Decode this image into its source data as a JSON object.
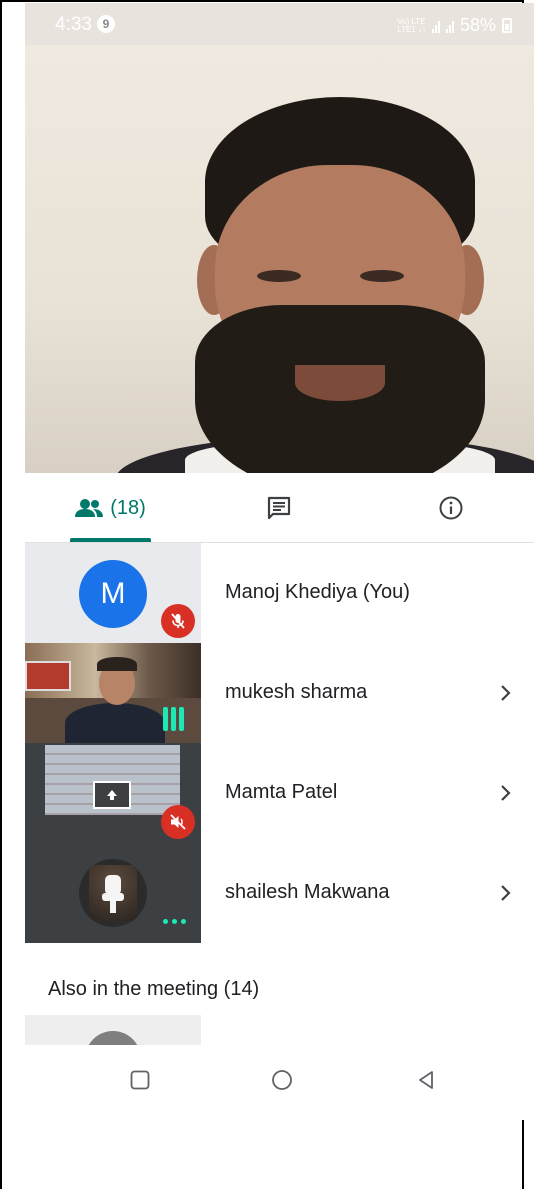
{
  "status_bar": {
    "time": "4:33",
    "notification_count": "9",
    "network_label": "Vo) LTE\nLTE1 ↓↑",
    "battery": "58%"
  },
  "tabs": {
    "people_count": "(18)",
    "people_icon": "people-icon",
    "chat_icon": "chat-icon",
    "info_icon": "info-icon",
    "accent_color": "#00796b"
  },
  "participants": [
    {
      "name": "Manoj Khediya (You)",
      "avatar_letter": "M",
      "status": "muted"
    },
    {
      "name": "mukesh sharma",
      "status": "speaking"
    },
    {
      "name": "Mamta Patel",
      "status": "muted"
    },
    {
      "name": "shailesh Makwana",
      "status": "more"
    }
  ],
  "also_in_meeting": {
    "label": "Also in the meeting (14)"
  },
  "colors": {
    "muted_badge": "#d93025",
    "avatar_blue": "#1a73e8",
    "speaking_teal": "#1de9b6"
  }
}
